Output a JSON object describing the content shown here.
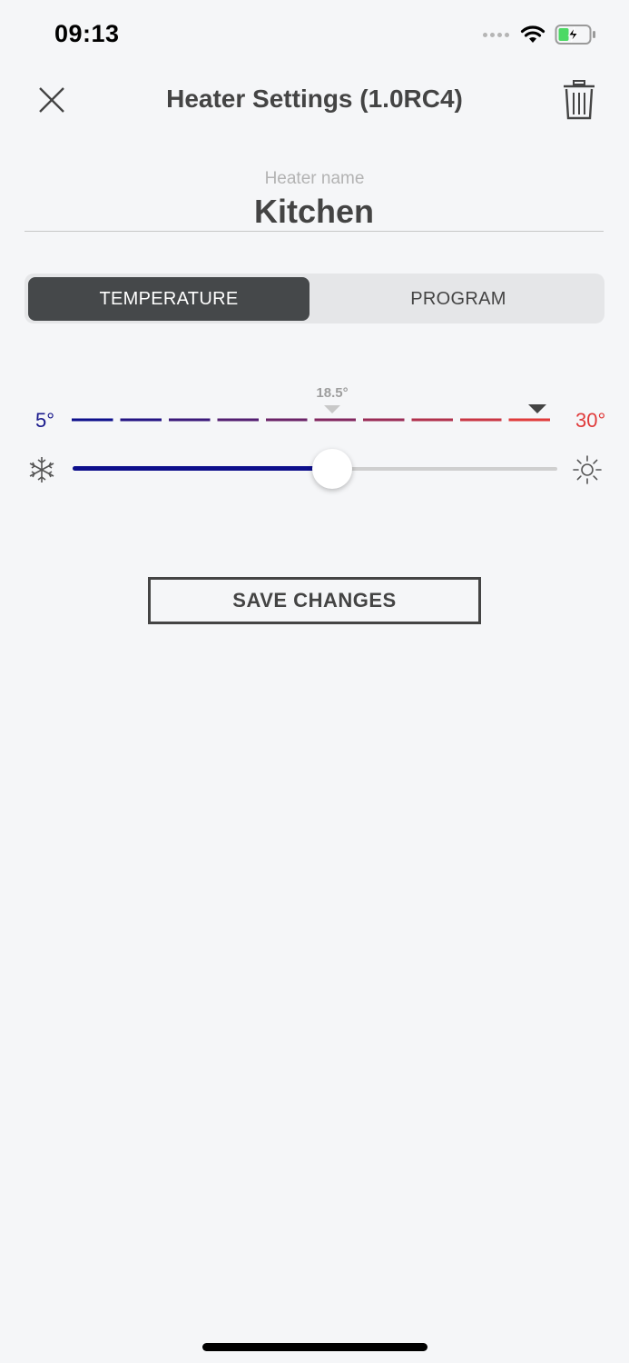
{
  "status_bar": {
    "time": "09:13"
  },
  "header": {
    "title": "Heater Settings (1.0RC4)",
    "close_icon": "close-icon",
    "trash_icon": "trash-icon"
  },
  "heater_name": {
    "caption": "Heater name",
    "value": "Kitchen"
  },
  "tabs": [
    {
      "label": "TEMPERATURE",
      "selected": true
    },
    {
      "label": "PROGRAM",
      "selected": false
    }
  ],
  "temperature": {
    "min_label": "5°",
    "max_label": "30°",
    "min": 5,
    "max": 30,
    "current_label": "18.5°",
    "current": 18.5,
    "target_fraction": 1.0,
    "slider_fraction": 0.535,
    "cold_color": "#0d0f8c",
    "hot_color": "#e03b3b",
    "cold_icon": "snowflake-icon",
    "hot_icon": "sun-icon"
  },
  "actions": {
    "save_label": "SAVE CHANGES"
  }
}
